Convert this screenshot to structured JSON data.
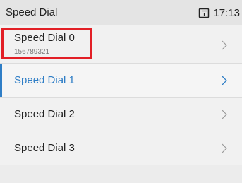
{
  "status_bar": {
    "title": "Speed Dial",
    "time": "17:13",
    "icon": "tablet-icon"
  },
  "list": {
    "items": [
      {
        "label": "Speed Dial 0",
        "number": "156789321"
      },
      {
        "label": "Speed Dial 1"
      },
      {
        "label": "Speed Dial 2"
      },
      {
        "label": "Speed Dial 3"
      }
    ]
  },
  "colors": {
    "accent": "#2f7ec6",
    "highlight_box": "#e21f26"
  }
}
